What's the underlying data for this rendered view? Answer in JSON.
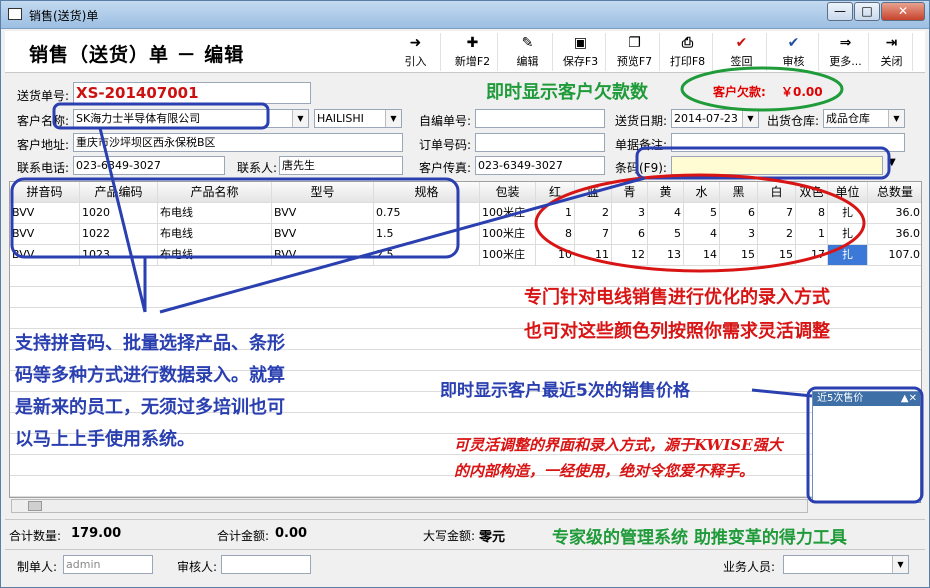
{
  "window": {
    "title": "销售(送货)单",
    "btn_min": "—",
    "btn_max": "□",
    "btn_close": "✕"
  },
  "header": {
    "title": "销售（送货）单 － 编辑"
  },
  "toolbar": [
    {
      "name": "import",
      "label": "引入",
      "icon": "➜"
    },
    {
      "name": "new",
      "label": "新增F2",
      "icon": "✚"
    },
    {
      "name": "edit",
      "label": "编辑",
      "icon": "✎"
    },
    {
      "name": "save",
      "label": "保存F3",
      "icon": "▣"
    },
    {
      "name": "preview",
      "label": "预览F7",
      "icon": "❐"
    },
    {
      "name": "print",
      "label": "打印F8",
      "icon": "⎙"
    },
    {
      "name": "sign",
      "label": "签回",
      "icon": "✔"
    },
    {
      "name": "audit",
      "label": "审核",
      "icon": "✔"
    },
    {
      "name": "more",
      "label": "更多...",
      "icon": "⇒"
    },
    {
      "name": "close",
      "label": "关闭",
      "icon": "⇥"
    }
  ],
  "form": {
    "order_no_label": "送货单号:",
    "order_no": "XS-201407001",
    "customer_label": "客户名称:",
    "customer": "SK海力士半导体有限公司",
    "customer_code": "HAILISHI",
    "address_label": "客户地址:",
    "address": "重庆市沙坪坝区西永保税B区",
    "phone_label": "联系电话:",
    "phone": "023-6349-3027",
    "contact_label": "联系人:",
    "contact": "唐先生",
    "self_no_label": "自编单号:",
    "self_no": "",
    "order_code_label": "订单号码:",
    "order_code": "",
    "fax_label": "客户传真:",
    "fax": "023-6349-3027",
    "date_label": "送货日期:",
    "date": "2014-07-23",
    "warehouse_label": "出货仓库:",
    "warehouse": "成品仓库",
    "remark_label": "单据备注:",
    "remark": "",
    "barcode_label": "条码(F9):",
    "barcode": "",
    "debt_label": "客户欠款:",
    "debt": "￥0.00"
  },
  "grid": {
    "columns": [
      "拼音码",
      "产品编码",
      "产品名称",
      "型号",
      "规格",
      "包装",
      "红",
      "蓝",
      "青",
      "黄",
      "水",
      "黑",
      "白",
      "双色",
      "单位",
      "总数量"
    ],
    "rows": [
      [
        "BVV",
        "1020",
        "布电线",
        "BVV",
        "0.75",
        "100米庄",
        "1",
        "2",
        "3",
        "4",
        "5",
        "6",
        "7",
        "8",
        "扎",
        "36.0"
      ],
      [
        "BVV",
        "1022",
        "布电线",
        "BVV",
        "1.5",
        "100米庄",
        "8",
        "7",
        "6",
        "5",
        "4",
        "3",
        "2",
        "1",
        "扎",
        "36.0"
      ],
      [
        "BVV",
        "1023",
        "布电线",
        "BVV",
        "2.5",
        "100米庄",
        "10",
        "11",
        "12",
        "13",
        "14",
        "15",
        "15",
        "17",
        "扎",
        "107.0"
      ]
    ]
  },
  "status": {
    "qty_label": "合计数量:",
    "qty": "179.00",
    "amount_label": "合计金额:",
    "amount": "0.00",
    "upper_label": "大写金额:",
    "upper": "零元"
  },
  "footer": {
    "maker_label": "制单人:",
    "maker": "admin",
    "auditor_label": "审核人:",
    "auditor": "",
    "sales_label": "业务人员:",
    "sales": ""
  },
  "panel": {
    "title": "近5次售价"
  },
  "annotations": {
    "debt_tip": "即时显示客户欠款数",
    "color_tip1": "专门针对电线销售进行优化的录入方式",
    "color_tip2": "也可对这些颜色列按照你需求灵活调整",
    "input_tip": [
      "支持拼音码、批量选择产品、条形",
      "码等多种方式进行数据录入。就算",
      "是新来的员工，无须过多培训也可",
      "以马上上手使用系统。"
    ],
    "price_tip": "即时显示客户最近5次的销售价格",
    "flex_tip": [
      "可灵活调整的界面和录入方式，源于KWISE强大",
      "的内部构造，一经使用，绝对令您爱不释手。"
    ],
    "slogan": "专家级的管理系统  助推变革的得力工具"
  },
  "colors": {
    "accent_red": "#cc1111",
    "ann_blue": "#2a3fb0",
    "ann_green": "#1f9b3a",
    "ann_red": "#d81414",
    "debt_red": "#e00000"
  }
}
